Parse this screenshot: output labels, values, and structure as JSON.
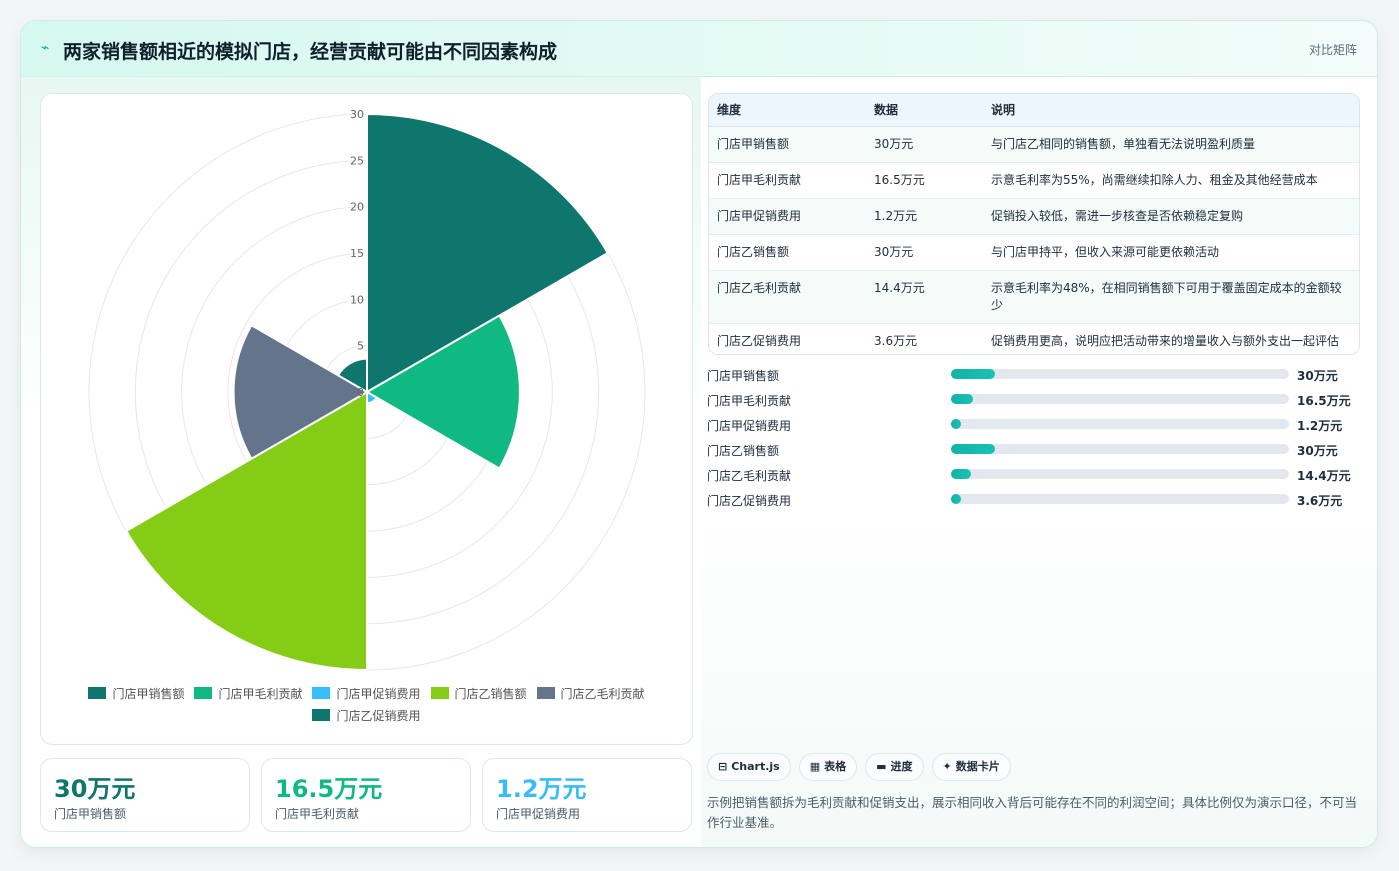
{
  "header": {
    "title": "两家销售额相近的模拟门店，经营贡献可能由不同因素构成",
    "badge": "对比矩阵"
  },
  "colors": {
    "accent": "#13a8a0",
    "series": [
      "#0f766e",
      "#10b981",
      "#38bdf8",
      "#84cc16",
      "#64748b",
      "#0f766e"
    ]
  },
  "chart_data": {
    "type": "polarArea",
    "categories": [
      "门店甲销售额",
      "门店甲毛利贡献",
      "门店甲促销费用",
      "门店乙销售额",
      "门店乙毛利贡献",
      "门店乙促销费用"
    ],
    "values": [
      30,
      16.5,
      1.2,
      30,
      14.4,
      3.6
    ],
    "unit": "万元",
    "rlim": [
      0,
      30
    ],
    "rticks": [
      0,
      5,
      10,
      15,
      20,
      25,
      30
    ],
    "legend_position": "bottom"
  },
  "stats": [
    {
      "value": "30万元",
      "label": "门店甲销售额",
      "color": "#0f766e"
    },
    {
      "value": "16.5万元",
      "label": "门店甲毛利贡献",
      "color": "#10b981"
    },
    {
      "value": "1.2万元",
      "label": "门店甲促销费用",
      "color": "#38bdf8"
    }
  ],
  "table": {
    "headers": [
      "维度",
      "数据",
      "说明"
    ],
    "rows": [
      {
        "dim": "门店甲销售额",
        "val": "30万元",
        "desc": "与门店乙相同的销售额，单独看无法说明盈利质量"
      },
      {
        "dim": "门店甲毛利贡献",
        "val": "16.5万元",
        "desc": "示意毛利率为55%，尚需继续扣除人力、租金及其他经营成本"
      },
      {
        "dim": "门店甲促销费用",
        "val": "1.2万元",
        "desc": "促销投入较低，需进一步核查是否依赖稳定复购"
      },
      {
        "dim": "门店乙销售额",
        "val": "30万元",
        "desc": "与门店甲持平，但收入来源可能更依赖活动"
      },
      {
        "dim": "门店乙毛利贡献",
        "val": "14.4万元",
        "desc": "示意毛利率为48%，在相同销售额下可用于覆盖固定成本的金额较少"
      },
      {
        "dim": "门店乙促销费用",
        "val": "3.6万元",
        "desc": "促销费用更高，说明应把活动带来的增量收入与额外支出一起评估"
      }
    ]
  },
  "bars": [
    {
      "label": "门店甲销售额",
      "value": "30万元",
      "fraction": 0.13
    },
    {
      "label": "门店甲毛利贡献",
      "value": "16.5万元",
      "fraction": 0.065
    },
    {
      "label": "门店甲促销费用",
      "value": "1.2万元",
      "fraction": 0.03
    },
    {
      "label": "门店乙销售额",
      "value": "30万元",
      "fraction": 0.13
    },
    {
      "label": "门店乙毛利贡献",
      "value": "14.4万元",
      "fraction": 0.058
    },
    {
      "label": "门店乙促销费用",
      "value": "3.6万元",
      "fraction": 0.03
    }
  ],
  "tags": [
    {
      "icon": "⊟",
      "icon_name": "chart-icon",
      "label": "Chart.js"
    },
    {
      "icon": "▦",
      "icon_name": "table-icon",
      "label": "表格"
    },
    {
      "icon": "▬",
      "icon_name": "progress-icon",
      "label": "进度"
    },
    {
      "icon": "✦",
      "icon_name": "sparkle-icon",
      "label": "数据卡片"
    }
  ],
  "note": "示例把销售额拆为毛利贡献和促销支出，展示相同收入背后可能存在不同的利润空间；具体比例仅为演示口径，不可当作行业基准。"
}
